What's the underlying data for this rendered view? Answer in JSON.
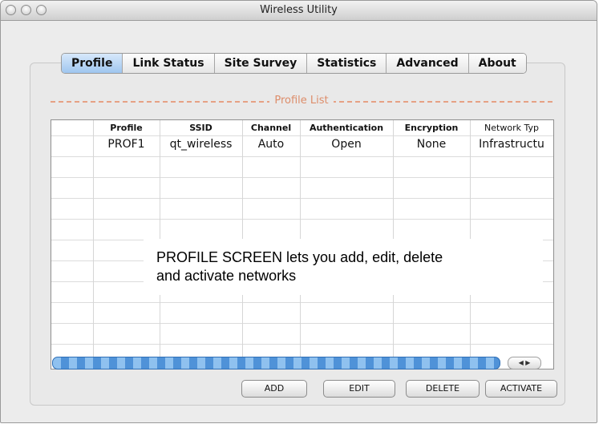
{
  "window": {
    "title": "Wireless Utility"
  },
  "tabs": [
    {
      "label": "Profile",
      "active": true
    },
    {
      "label": "Link Status"
    },
    {
      "label": "Site Survey"
    },
    {
      "label": "Statistics"
    },
    {
      "label": "Advanced"
    },
    {
      "label": "About"
    }
  ],
  "section": {
    "title": "Profile List"
  },
  "table": {
    "columns": [
      "Profile",
      "SSID",
      "Channel",
      "Authentication",
      "Encryption",
      "Network Typ"
    ],
    "rows": [
      [
        "PROF1",
        "qt_wireless",
        "Auto",
        "Open",
        "None",
        "Infrastructu"
      ]
    ]
  },
  "overlay": {
    "line1": "PROFILE SCREEN lets you add, edit, delete",
    "line2": "and activate networks"
  },
  "buttons": {
    "add": "ADD",
    "edit": "EDIT",
    "delete": "DELETE",
    "activate": "ACTIVATE"
  },
  "colors": {
    "accent": "#9fc6ef",
    "section_title": "#dd8d6a",
    "scroll": "#4f92d8"
  }
}
